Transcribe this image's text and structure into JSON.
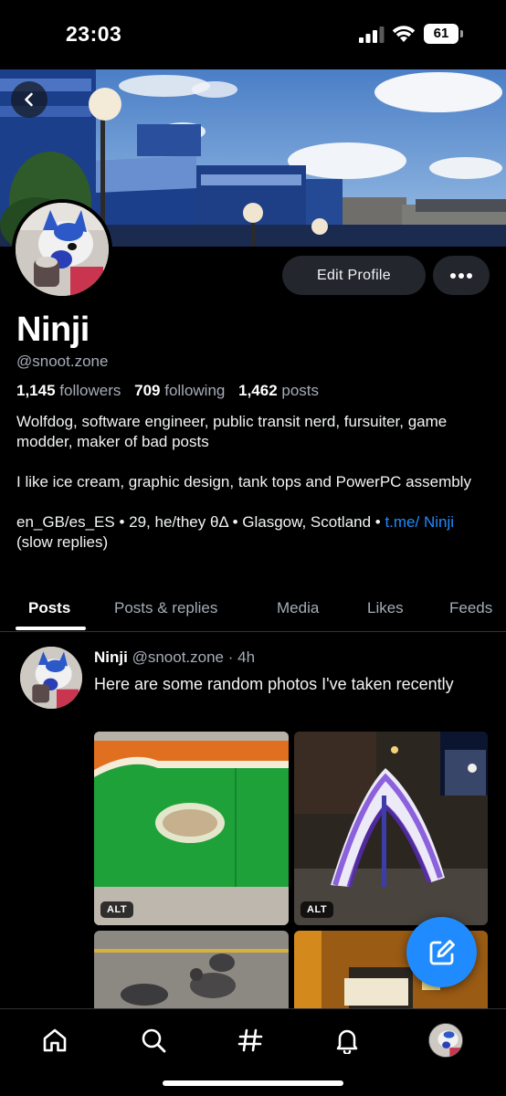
{
  "status_bar": {
    "time": "23:03",
    "battery": "61"
  },
  "profile": {
    "display_name": "Ninji",
    "handle": "@snoot.zone",
    "followers_count": "1,145",
    "followers_label": "followers",
    "following_count": "709",
    "following_label": "following",
    "posts_count": "1,462",
    "posts_label": "posts",
    "bio_line1": "Wolfdog, software engineer, public transit nerd, fursuiter, game modder, maker of bad posts",
    "bio_line2": "I like ice cream, graphic design, tank tops and PowerPC assembly",
    "bio_line3_text": "en_GB/es_ES • 29, he/they θΔ • Glasgow, Scotland • ",
    "bio_line3_link": "t.me/ Ninji",
    "bio_line3_suffix": " (slow replies)"
  },
  "actions": {
    "edit_profile": "Edit Profile"
  },
  "tabs": [
    "Posts",
    "Posts & replies",
    "Media",
    "Likes",
    "Feeds"
  ],
  "active_tab": "Posts",
  "post": {
    "author": "Ninji",
    "handle": "@snoot.zone",
    "separator": "·",
    "time": "4h",
    "text": "Here are some random photos I've taken recently",
    "alt_label": "ALT"
  },
  "colors": {
    "accent": "#208bfe",
    "background": "#000000",
    "muted": "#a5acb7",
    "button_bg": "#23262d"
  },
  "icons": {
    "back": "chevron-left-icon",
    "more": "ellipsis-icon",
    "compose": "compose-icon",
    "nav": [
      "home-icon",
      "search-icon",
      "hashtag-icon",
      "bell-icon",
      "profile-avatar"
    ]
  }
}
